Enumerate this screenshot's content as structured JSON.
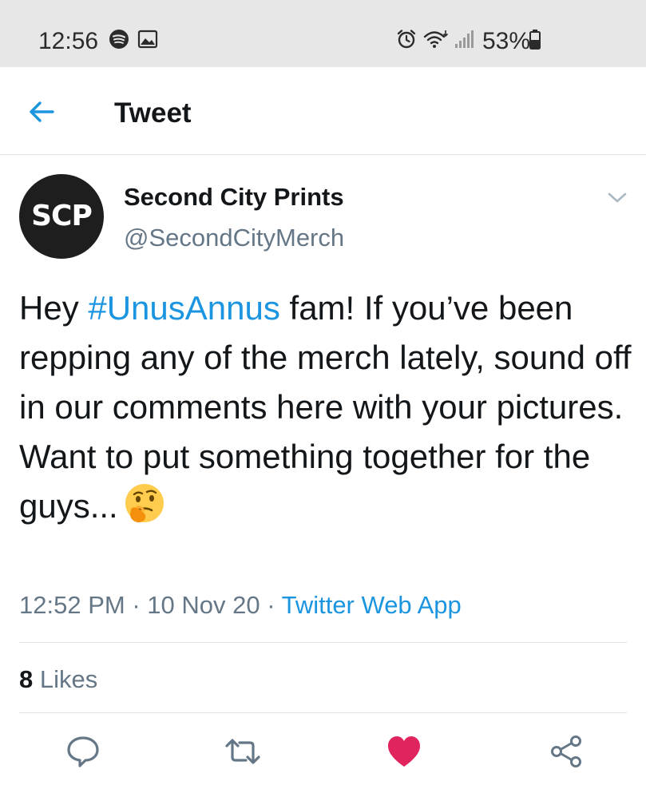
{
  "status_bar": {
    "time": "12:56",
    "left_icons": [
      "spotify-icon",
      "image-icon"
    ],
    "right_icons": [
      "alarm-icon",
      "wifi-icon",
      "signal-icon",
      "battery-icon"
    ],
    "battery": "53%"
  },
  "header": {
    "title": "Tweet",
    "back_icon": "arrow-left-icon"
  },
  "tweet": {
    "avatar_text": "SCP",
    "display_name": "Second City Prints",
    "handle": "@SecondCityMerch",
    "text_before_hashtag": "Hey ",
    "hashtag": "#UnusAnnus",
    "text_after_hashtag": " fam! If you’ve been repping any of the merch lately, sound off in our comments here with your pictures. Want to put something together for the guys...",
    "emoji": "thinking-face-emoji",
    "time": "12:52 PM",
    "separator": " · ",
    "date": "10 Nov 20",
    "source": "Twitter Web App"
  },
  "engagement": {
    "likes_count": "8",
    "likes_label": " Likes"
  },
  "actions": [
    "reply-icon",
    "retweet-icon",
    "like-icon",
    "share-icon"
  ],
  "colors": {
    "accent": "#1b95e0",
    "like": "#e0245e",
    "secondary_text": "#657786",
    "icon_gray": "#657786",
    "status_bar_bg": "#e7e7e7"
  }
}
